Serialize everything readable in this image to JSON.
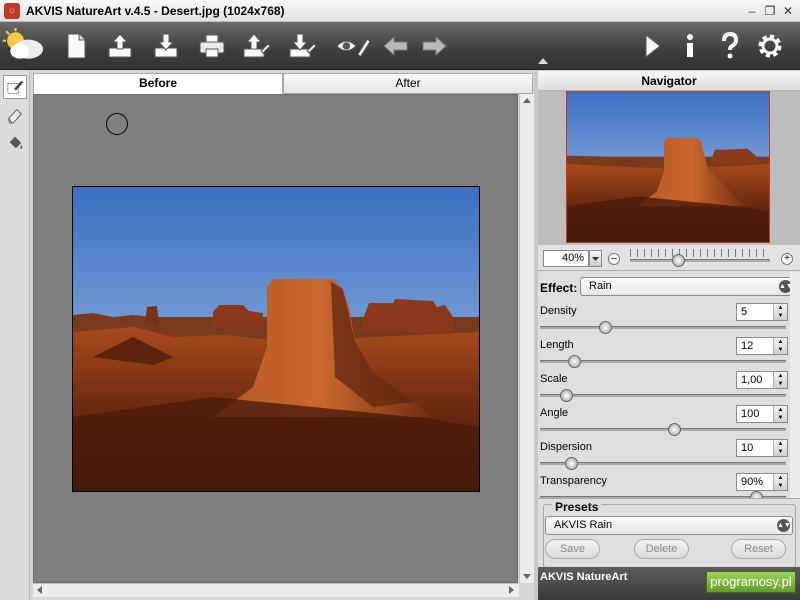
{
  "window": {
    "title": "AKVIS NatureArt v.4.5 - Desert.jpg (1024x768)",
    "controls": [
      "minimize-icon",
      "restore-icon",
      "close-icon"
    ]
  },
  "toolbar": {
    "left_buttons": [
      "app-logo-icon",
      "new-file-icon",
      "open-file-icon",
      "save-file-icon",
      "print-icon",
      "import-preset-icon",
      "export-preset-icon",
      "hide-show-icon",
      "undo-icon",
      "redo-icon"
    ],
    "right_buttons": [
      "run-icon",
      "info-icon",
      "help-icon",
      "settings-icon"
    ]
  },
  "left_tools": [
    "selection-brush-icon",
    "eraser-icon",
    "fill-bucket-icon"
  ],
  "view_tabs": [
    {
      "label": "Before",
      "active": true
    },
    {
      "label": "After",
      "active": false
    }
  ],
  "navigator": {
    "title": "Navigator",
    "zoom_value": "40%",
    "zoom_slider_position": 0.34
  },
  "effect": {
    "label": "Effect:",
    "selected": "Rain",
    "params": [
      {
        "label": "Density",
        "value": "5",
        "slider": 0.27
      },
      {
        "label": "Length",
        "value": "12",
        "slider": 0.14
      },
      {
        "label": "Scale",
        "value": "1,00",
        "slider": 0.11
      },
      {
        "label": "Angle",
        "value": "100",
        "slider": 0.56
      },
      {
        "label": "Dispersion",
        "value": "10",
        "slider": 0.13
      },
      {
        "label": "Transparency",
        "value": "90%",
        "slider": 0.9
      }
    ]
  },
  "presets": {
    "title": "Presets",
    "selected": "AKVIS Rain",
    "buttons": [
      "Save",
      "Delete",
      "Reset"
    ]
  },
  "status": {
    "text": "AKVIS NatureArt",
    "watermark": "programosy.pl"
  },
  "colors": {
    "toolbar_dark": "#3e3e3e",
    "canvas_gray": "#7f7f7f",
    "panel_gray": "#dedede",
    "nav_frame": "#c0392b"
  }
}
